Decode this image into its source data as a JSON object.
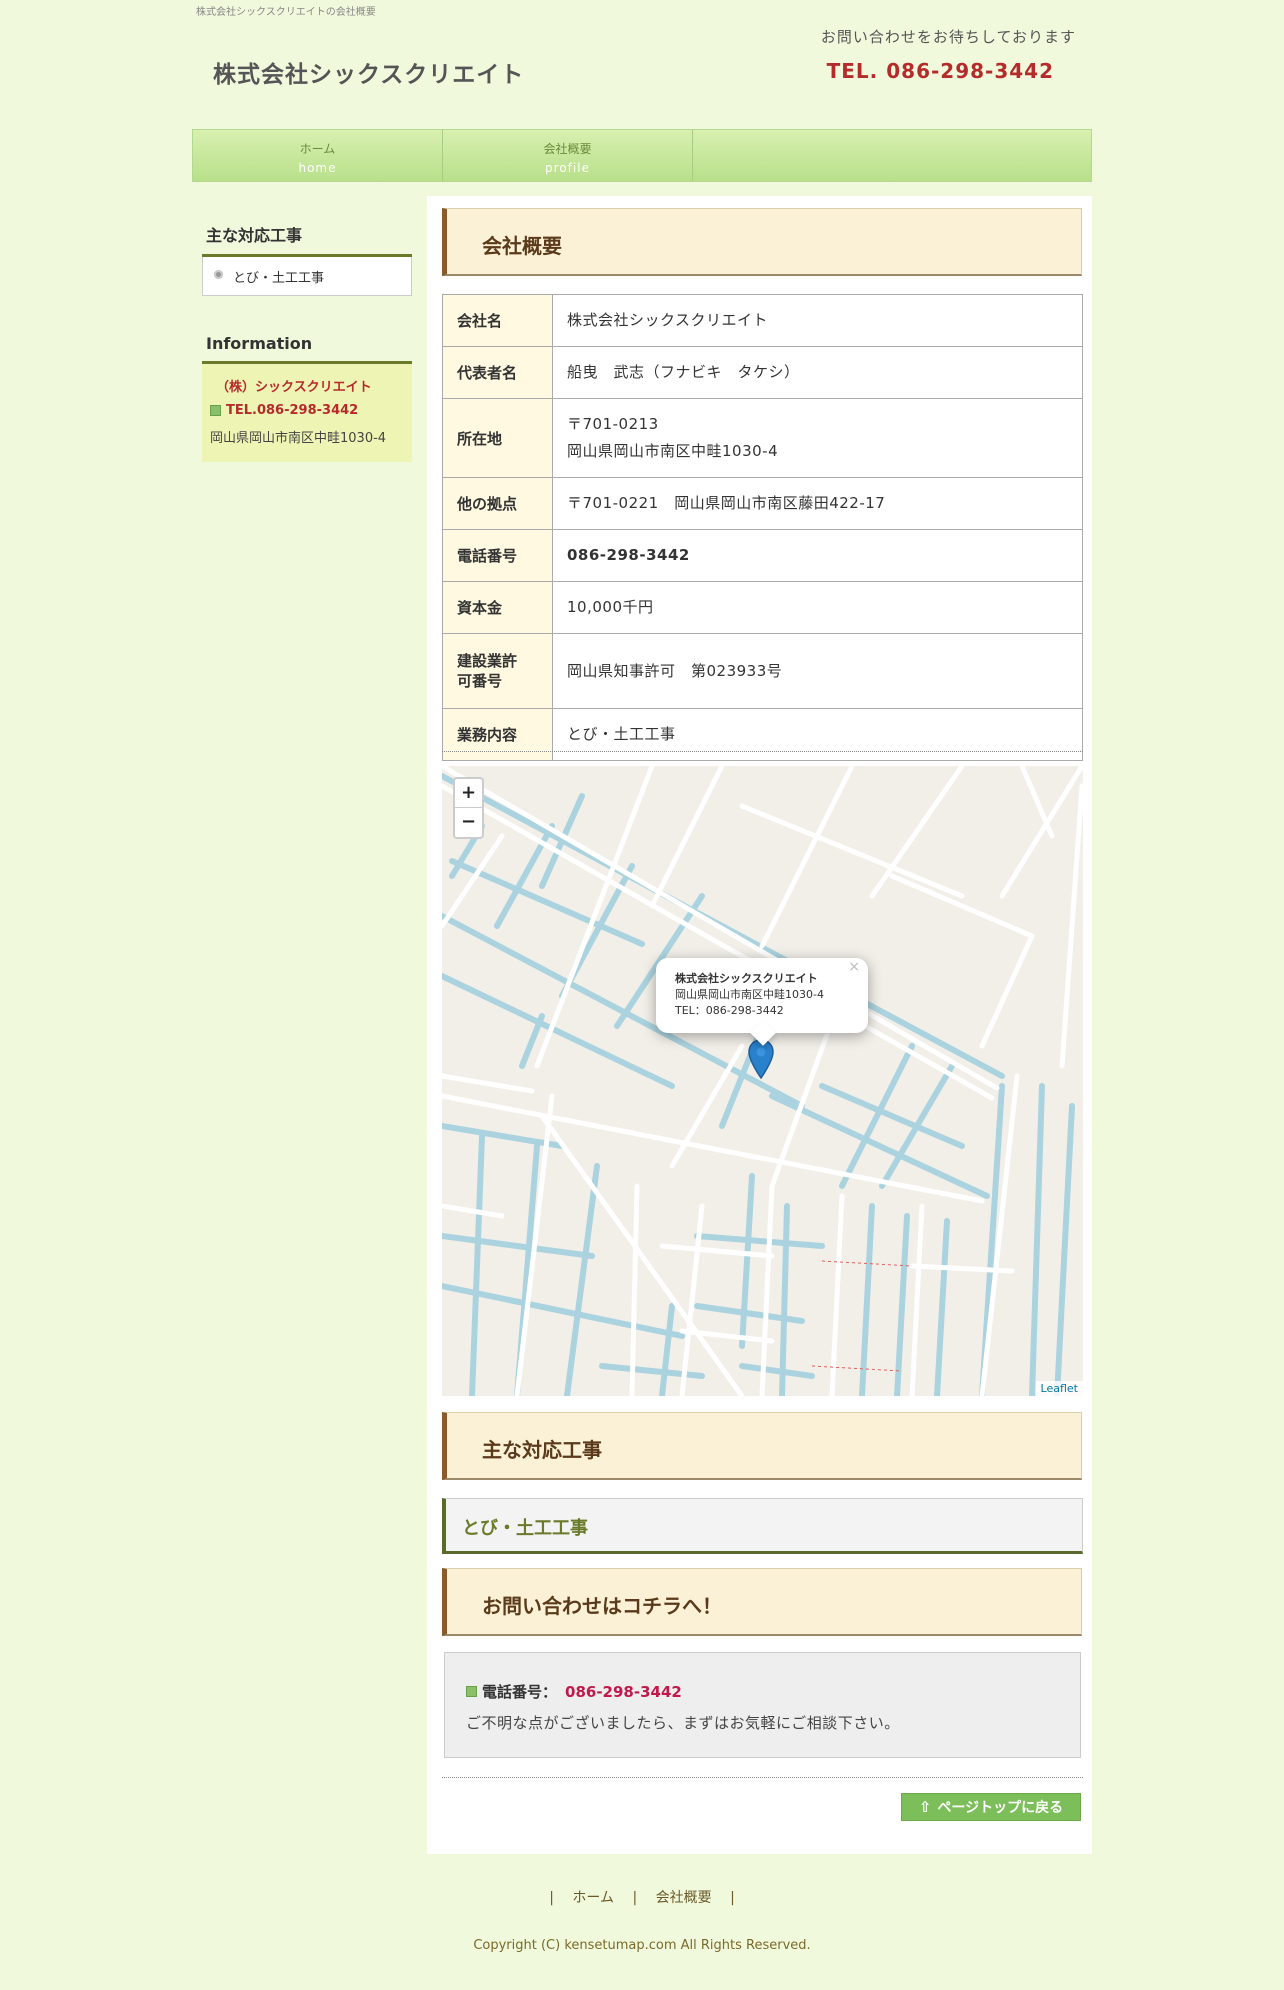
{
  "header": {
    "caption": "株式会社シックスクリエイトの会社概要",
    "site_title": "株式会社シックスクリエイト",
    "contact_message": "お問い合わせをお待ちしております",
    "tel": "TEL. 086-298-3442"
  },
  "nav": {
    "items": [
      {
        "label": "ホーム",
        "sub": "home"
      },
      {
        "label": "会社概要",
        "sub": "profile"
      }
    ]
  },
  "sidebar": {
    "works_heading": "主な対応工事",
    "works_link": "とび・土工工事",
    "info_heading": "Information",
    "info_name": "（株）シックスクリエイト",
    "info_tel": "TEL.086-298-3442",
    "info_address": "岡山県岡山市南区中畦1030-4"
  },
  "main": {
    "profile_heading": "会社概要",
    "table": [
      {
        "key": "会社名",
        "value": "株式会社シックスクリエイト"
      },
      {
        "key": "代表者名",
        "value": "船曳　武志（フナビキ　タケシ）"
      },
      {
        "key": "所在地",
        "value_line1": "〒701-0213",
        "value_line2": "岡山県岡山市南区中畦1030-4"
      },
      {
        "key": "他の拠点",
        "value": "〒701-0221　岡山県岡山市南区藤田422-17"
      },
      {
        "key": "電話番号",
        "value": "086-298-3442"
      },
      {
        "key": "資本金",
        "value": "10,000千円"
      },
      {
        "key_line1": "建設業許",
        "key_line2": "可番号",
        "value": "岡山県知事許可　第023933号"
      },
      {
        "key": "業務内容",
        "value": "とび・土工工事"
      }
    ],
    "map": {
      "zoom_in": "+",
      "zoom_out": "−",
      "popup_name": "株式会社シックスクリエイト",
      "popup_address": "岡山県岡山市南区中畦1030-4",
      "popup_tel": "TEL：086-298-3442",
      "popup_close": "×",
      "attribution": "Leaflet",
      "road_color": "#ffffff",
      "water_color": "#aad3df",
      "land_color": "#f2efe9",
      "marker_color": "#2a81cb"
    },
    "works_heading": "主な対応工事",
    "works_item": "とび・土工工事",
    "contact_heading": "お問い合わせはコチラへ！",
    "contact_tel_label": "電話番号：",
    "contact_tel": "086-298-3442",
    "contact_note": "ご不明な点がございましたら、まずはお気軽にご相談下さい。",
    "pagetop_label": "ページトップに戻る"
  },
  "footer": {
    "separator": "|",
    "links": [
      "ホーム",
      "会社概要"
    ],
    "copyright": "Copyright (C) kensetumap.com All Rights Reserved."
  },
  "colors": {
    "background": "#f1f9dc",
    "accent_red": "#b52b2b",
    "tel_pink": "#c0194a",
    "nav_green": "#b8e08a",
    "heading_brown": "#8a5a2a"
  }
}
